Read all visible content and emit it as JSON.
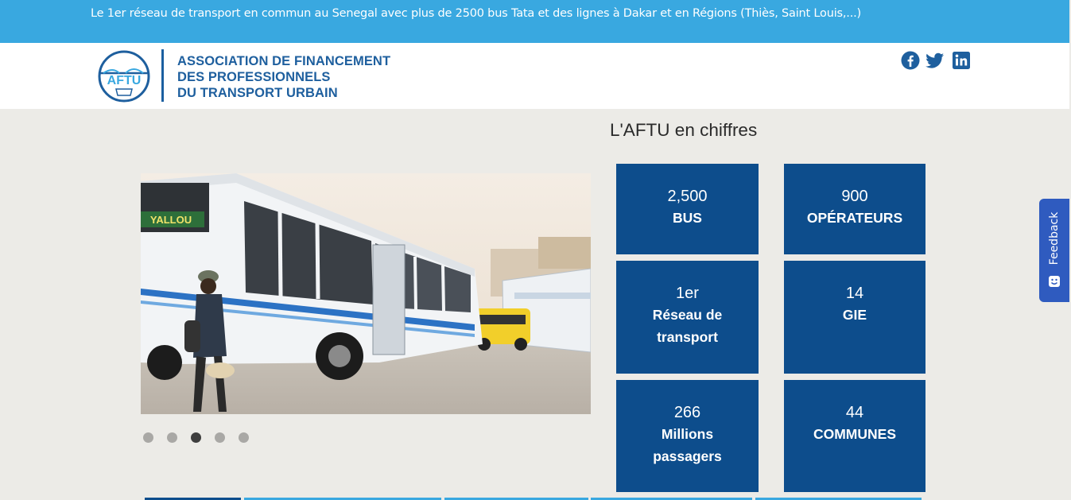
{
  "topbar": {
    "message": "Le 1er réseau de transport en commun au Senegal avec plus de 2500 bus Tata et des lignes à Dakar et en Régions (Thiès, Saint Louis,...)"
  },
  "header": {
    "logo_letters": "AFTU",
    "org_name_line1": "ASSOCIATION DE FINANCEMENT",
    "org_name_line2": "DES PROFESSIONNELS",
    "org_name_line3": "DU TRANSPORT URBAIN",
    "social_icons": [
      "facebook-icon",
      "twitter-icon",
      "linkedin-icon"
    ]
  },
  "carousel": {
    "slide_count": 5,
    "active_slide": 3,
    "bus_sign_text": "YALLOU"
  },
  "stats": {
    "title": "L'AFTU en chiffres",
    "tiles": [
      {
        "value": "2,500",
        "label": "BUS"
      },
      {
        "value": "900",
        "label": "OPÉRATEURS"
      },
      {
        "value": "1er",
        "label": "Réseau de transport"
      },
      {
        "value": "14",
        "label": "GIE"
      },
      {
        "value": "266",
        "label": "Millions passagers"
      },
      {
        "value": "44",
        "label": "COMMUNES"
      }
    ]
  },
  "feedback": {
    "label": "Feedback"
  },
  "colors": {
    "topbar": "#39a8e0",
    "brand_blue": "#1e5f9e",
    "tile_blue": "#0d4d8c",
    "background": "#ecebe7",
    "feedback_tab": "#2f5bbf"
  }
}
